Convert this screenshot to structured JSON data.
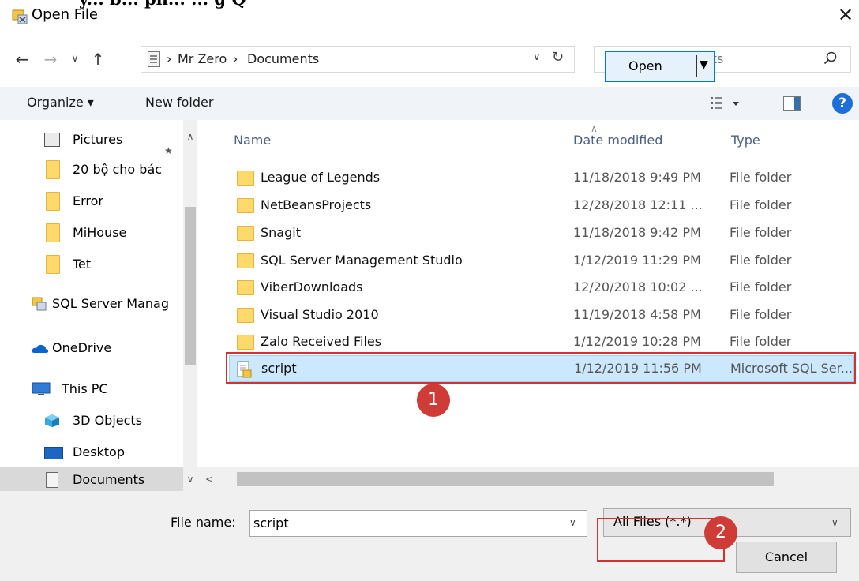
{
  "window": {
    "title": "Open File",
    "overlay_text": "y... b... ph... ... g Q"
  },
  "address": {
    "crumbs": [
      "Mr Zero",
      "Documents"
    ],
    "search_placeholder": "Search Documents"
  },
  "toolbar": {
    "organize": "Organize ▾",
    "new_folder": "New folder",
    "help": "?"
  },
  "nav": {
    "items": [
      {
        "label": "Pictures",
        "icon": "pictures-icon"
      },
      {
        "label": "20 bộ cho bác",
        "icon": "folder-icon"
      },
      {
        "label": "Error",
        "icon": "folder-icon"
      },
      {
        "label": "MiHouse",
        "icon": "folder-icon"
      },
      {
        "label": "Tet",
        "icon": "folder-icon"
      },
      {
        "label": "SQL Server Manag",
        "icon": "sql-server-icon"
      },
      {
        "label": "OneDrive",
        "icon": "onedrive-icon"
      },
      {
        "label": "This PC",
        "icon": "this-pc-icon"
      },
      {
        "label": "3D Objects",
        "icon": "3d-objects-icon"
      },
      {
        "label": "Desktop",
        "icon": "desktop-icon"
      },
      {
        "label": "Documents",
        "icon": "documents-icon"
      }
    ]
  },
  "columns": {
    "name": "Name",
    "date": "Date modified",
    "type": "Type"
  },
  "files": [
    {
      "name": "League of Legends",
      "date": "11/18/2018 9:49 PM",
      "type": "File folder"
    },
    {
      "name": "NetBeansProjects",
      "date": "12/28/2018 12:11 ...",
      "type": "File folder"
    },
    {
      "name": "Snagit",
      "date": "11/18/2018 9:42 PM",
      "type": "File folder"
    },
    {
      "name": "SQL Server Management Studio",
      "date": "1/12/2019 11:29 PM",
      "type": "File folder"
    },
    {
      "name": "ViberDownloads",
      "date": "12/20/2018 10:02 ...",
      "type": "File folder"
    },
    {
      "name": "Visual Studio 2010",
      "date": "11/19/2018 4:58 PM",
      "type": "File folder"
    },
    {
      "name": "Zalo Received Files",
      "date": "1/12/2019 10:28 PM",
      "type": "File folder"
    },
    {
      "name": "script",
      "date": "1/12/2019 11:56 PM",
      "type": "Microsoft SQL Ser..."
    }
  ],
  "footer": {
    "file_name_label": "File name:",
    "file_name_value": "script",
    "filter": "All Files (*.*)",
    "open": "Open",
    "cancel": "Cancel"
  },
  "annotations": {
    "badge1": "1",
    "badge2": "2"
  },
  "colors": {
    "highlight": "#d63030",
    "selection": "#cce8ff",
    "accent": "#0078d7"
  }
}
